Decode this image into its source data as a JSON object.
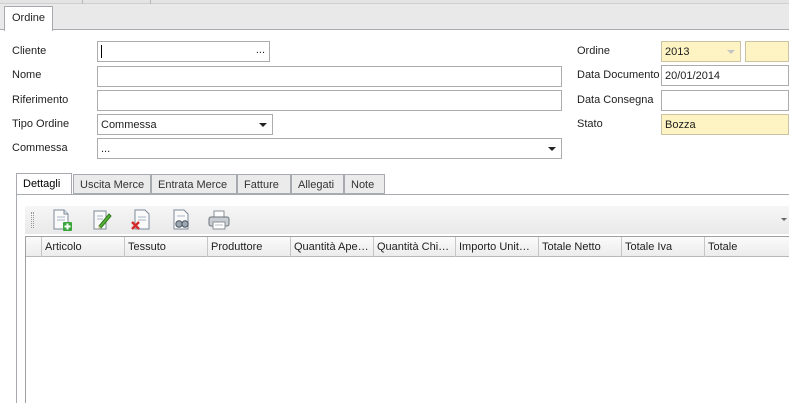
{
  "document_tab": {
    "label": "Ordine"
  },
  "form": {
    "cliente": {
      "label": "Cliente",
      "value": "",
      "button": "..."
    },
    "nome": {
      "label": "Nome",
      "value": ""
    },
    "riferimento": {
      "label": "Riferimento",
      "value": ""
    },
    "tipo_ordine": {
      "label": "Tipo Ordine",
      "value": "Commessa"
    },
    "commessa": {
      "label": "Commessa",
      "value": "..."
    },
    "ordine": {
      "label": "Ordine",
      "year": "2013",
      "number": ""
    },
    "data_documento": {
      "label": "Data Documento",
      "value": "20/01/2014"
    },
    "data_consegna": {
      "label": "Data Consegna",
      "value": ""
    },
    "stato": {
      "label": "Stato",
      "value": "Bozza"
    }
  },
  "detail_tabs": [
    {
      "label": "Dettagli",
      "active": true
    },
    {
      "label": "Uscita Merce"
    },
    {
      "label": "Entrata Merce"
    },
    {
      "label": "Fatture"
    },
    {
      "label": "Allegati"
    },
    {
      "label": "Note"
    }
  ],
  "toolbar": {
    "icons": [
      "new-document-icon",
      "edit-document-icon",
      "delete-document-icon",
      "view-document-icon",
      "print-icon"
    ]
  },
  "grid": {
    "columns": [
      "Articolo",
      "Tessuto",
      "Produttore",
      "Quantità Ape…",
      "Quantità Chi…",
      "Importo Unit…",
      "Totale Netto",
      "Totale Iva",
      "Totale"
    ],
    "rows": []
  },
  "colors": {
    "highlight_field": "#fdf3c3",
    "border": "#a7abb0"
  }
}
